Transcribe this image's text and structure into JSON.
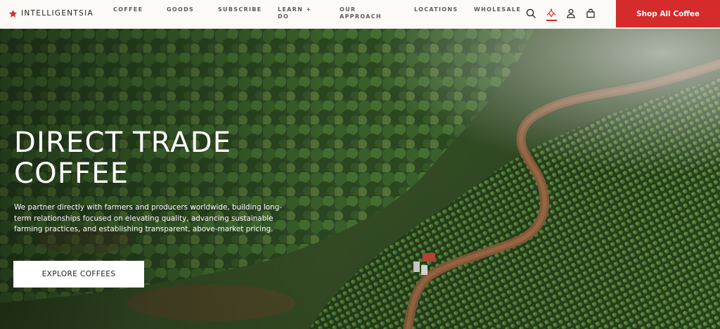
{
  "brand": {
    "name": "INTELLIGENTSIA",
    "accent_color": "#d52b2b"
  },
  "nav": {
    "items": [
      {
        "label": "COFFEE"
      },
      {
        "label": "GOODS"
      },
      {
        "label": "SUBSCRIBE"
      },
      {
        "label": "LEARN + DO"
      },
      {
        "label": "OUR APPROACH"
      },
      {
        "label": "LOCATIONS"
      },
      {
        "label": "WHOLESALE"
      }
    ],
    "icons": [
      "search-icon",
      "shipping-icon",
      "account-icon",
      "cart-icon"
    ],
    "shop_button": "Shop All Coffee"
  },
  "hero": {
    "title_line1": "DIRECT TRADE",
    "title_line2": "COFFEE",
    "description": "We partner directly with farmers and producers worldwide, building long-term relationships focused on elevating quality, advancing sustainable farming practices, and establishing transparent, above-market pricing.",
    "cta": "EXPLORE COFFEES"
  }
}
